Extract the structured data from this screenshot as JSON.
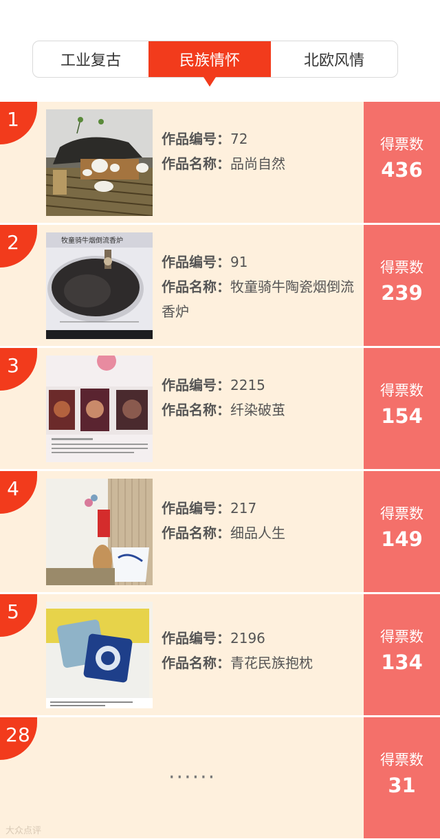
{
  "tabs": [
    {
      "label": "工业复古"
    },
    {
      "label": "民族情怀"
    },
    {
      "label": "北欧风情"
    }
  ],
  "active_tab": "民族情怀",
  "labels": {
    "id_label": "作品编号：",
    "name_label": "作品名称：",
    "votes_label": "得票数"
  },
  "entries": [
    {
      "rank": "1",
      "id": "72",
      "name": "品尚自然",
      "votes": "436"
    },
    {
      "rank": "2",
      "id": "91",
      "name": "牧童骑牛陶瓷烟倒流香炉",
      "votes": "239",
      "image_caption": "牧童骑牛烟倒流香炉"
    },
    {
      "rank": "3",
      "id": "2215",
      "name": "纤染破茧",
      "votes": "154"
    },
    {
      "rank": "4",
      "id": "217",
      "name": "细品人生",
      "votes": "149"
    },
    {
      "rank": "5",
      "id": "2196",
      "name": "青花民族抱枕",
      "votes": "134"
    }
  ],
  "self_entry": {
    "rank": "28",
    "placeholder": "······",
    "votes": "31"
  },
  "watermark": "大众点评",
  "colors": {
    "accent": "#f23b1c",
    "row_bg": "#fef0dd",
    "vote_bg": "#f4706a"
  }
}
